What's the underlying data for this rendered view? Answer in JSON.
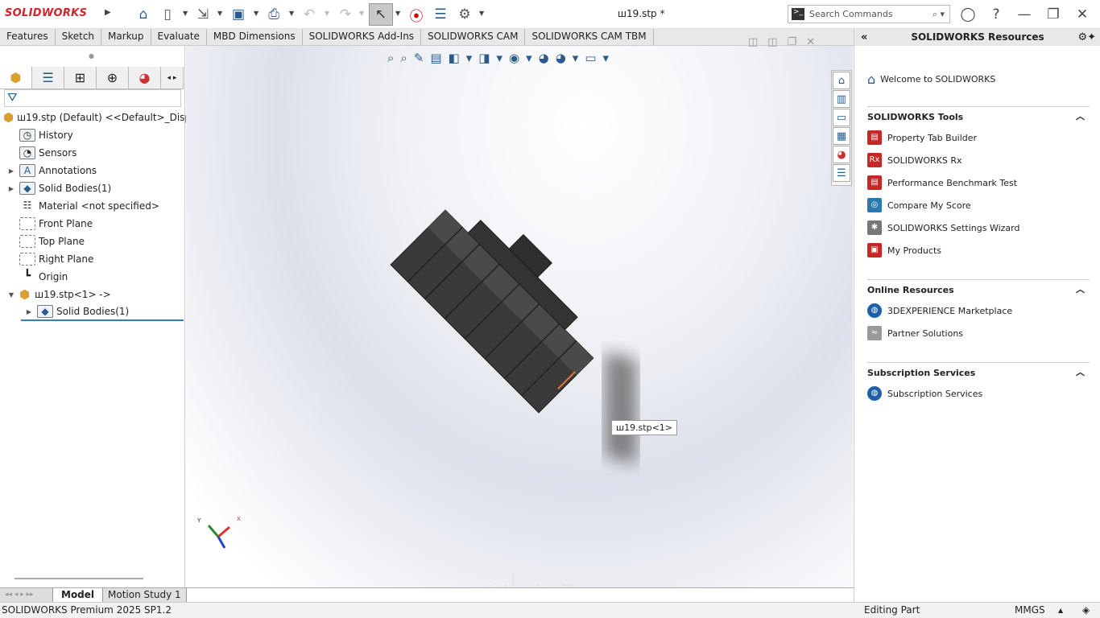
{
  "app": {
    "logo": "SOLIDWORKS",
    "title": "ш19.stp *"
  },
  "search": {
    "placeholder": "Search Commands"
  },
  "tabs": [
    "Features",
    "Sketch",
    "Markup",
    "Evaluate",
    "MBD Dimensions",
    "SOLIDWORKS Add-Ins",
    "SOLIDWORKS CAM",
    "SOLIDWORKS CAM TBM"
  ],
  "tree": {
    "root": "ш19.stp (Default) <<Default>_Display",
    "items": [
      {
        "label": "History",
        "icon": "history-icon"
      },
      {
        "label": "Sensors",
        "icon": "sensors-icon"
      },
      {
        "label": "Annotations",
        "icon": "annotations-icon"
      },
      {
        "label": "Solid Bodies(1)",
        "icon": "solid-bodies-icon"
      },
      {
        "label": "Material <not specified>",
        "icon": "material-icon"
      },
      {
        "label": "Front Plane",
        "icon": "plane-icon"
      },
      {
        "label": "Top Plane",
        "icon": "plane-icon"
      },
      {
        "label": "Right Plane",
        "icon": "plane-icon"
      },
      {
        "label": "Origin",
        "icon": "origin-icon"
      },
      {
        "label": "ш19.stp<1> ->",
        "icon": "part-icon"
      },
      {
        "label": "Solid Bodies(1)",
        "icon": "solid-bodies-icon"
      }
    ]
  },
  "viewport": {
    "tooltip": "ш19.stp<1>",
    "triad_x": "X",
    "triad_y": "Y"
  },
  "resources": {
    "title": "SOLIDWORKS Resources",
    "welcome": "Welcome to SOLIDWORKS",
    "sections": [
      {
        "title": "SOLIDWORKS Tools",
        "items": [
          "Property Tab Builder",
          "SOLIDWORKS Rx",
          "Performance Benchmark Test",
          "Compare My Score",
          "SOLIDWORKS Settings Wizard",
          "My Products"
        ]
      },
      {
        "title": "Online Resources",
        "items": [
          "3DEXPERIENCE Marketplace",
          "Partner Solutions"
        ]
      },
      {
        "title": "Subscription Services",
        "items": [
          "Subscription Services"
        ]
      }
    ]
  },
  "bottom_tabs": [
    "Model",
    "Motion Study 1"
  ],
  "status": {
    "version": "SOLIDWORKS Premium 2025 SP1.2",
    "mode": "Editing Part",
    "units": "MMGS"
  },
  "watermark": "خمسات"
}
